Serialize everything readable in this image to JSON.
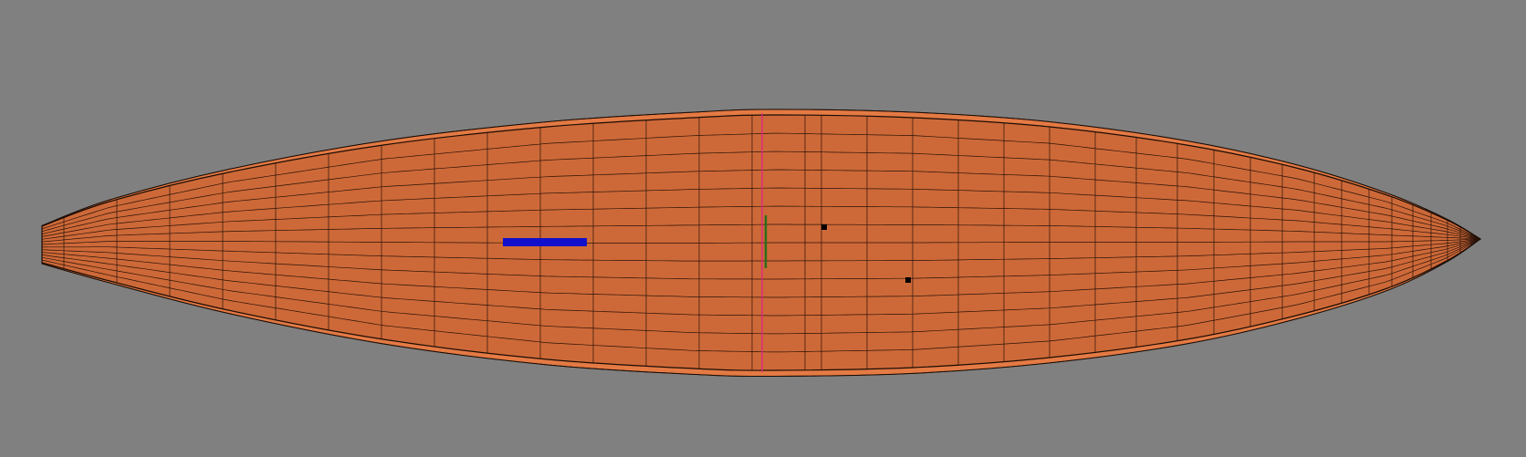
{
  "viewport": {
    "background": "#808080"
  },
  "hull": {
    "deck_color": "#cd6938",
    "rail_color": "#e47a44",
    "outline_color": "#1a0c05",
    "grid_line_color": "#2a1208"
  },
  "markers": {
    "fin_box_color": "#1010cc",
    "centerline_color": "#e0208a",
    "handle_color": "#2d6b1c",
    "point_color": "#000000"
  }
}
